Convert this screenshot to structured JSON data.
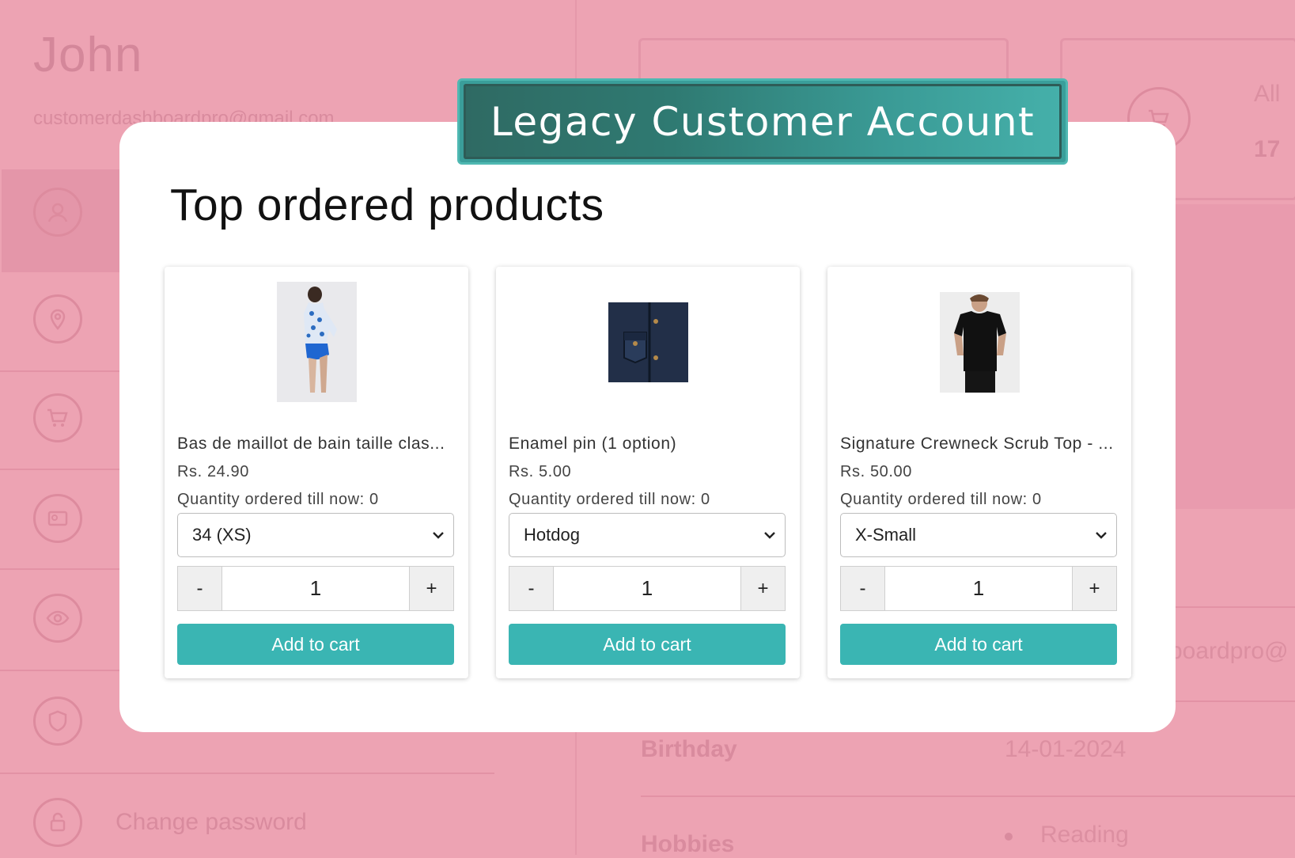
{
  "banner": {
    "title": "Legacy Customer Account"
  },
  "background": {
    "customer_name": "John",
    "customer_email": "customerdashboardpro@gmail.com",
    "change_password_label": "Change password",
    "orders_label": "All",
    "orders_count": "17",
    "email_partial": "boardpro@",
    "birthday_label": "Birthday",
    "birthday_value": "14-01-2024",
    "hobbies_label": "Hobbies",
    "hobby_item": "Reading",
    "sidebar_icons": [
      "user-icon",
      "location-pin-icon",
      "cart-icon",
      "id-card-icon",
      "eye-icon",
      "shield-icon",
      "lock-icon"
    ]
  },
  "section": {
    "title": "Top ordered products"
  },
  "products": [
    {
      "name": "Bas de maillot de bain taille clas...",
      "price": "Rs. 24.90",
      "quantity_ordered": "Quantity ordered till now: 0",
      "variant": "34 (XS)",
      "quantity": "1",
      "minus_label": "-",
      "plus_label": "+",
      "add_to_cart_label": "Add to cart"
    },
    {
      "name": "Enamel pin (1 option)",
      "price": "Rs. 5.00",
      "quantity_ordered": "Quantity ordered till now: 0",
      "variant": "Hotdog",
      "quantity": "1",
      "minus_label": "-",
      "plus_label": "+",
      "add_to_cart_label": "Add to cart"
    },
    {
      "name": "Signature Crewneck Scrub Top - ...",
      "price": "Rs. 50.00",
      "quantity_ordered": "Quantity ordered till now: 0",
      "variant": "X-Small",
      "quantity": "1",
      "minus_label": "-",
      "plus_label": "+",
      "add_to_cart_label": "Add to cart"
    }
  ],
  "colors": {
    "page_bg": "#eda3b3",
    "accent": "#3ab5b3",
    "banner": "#2f7a72"
  }
}
